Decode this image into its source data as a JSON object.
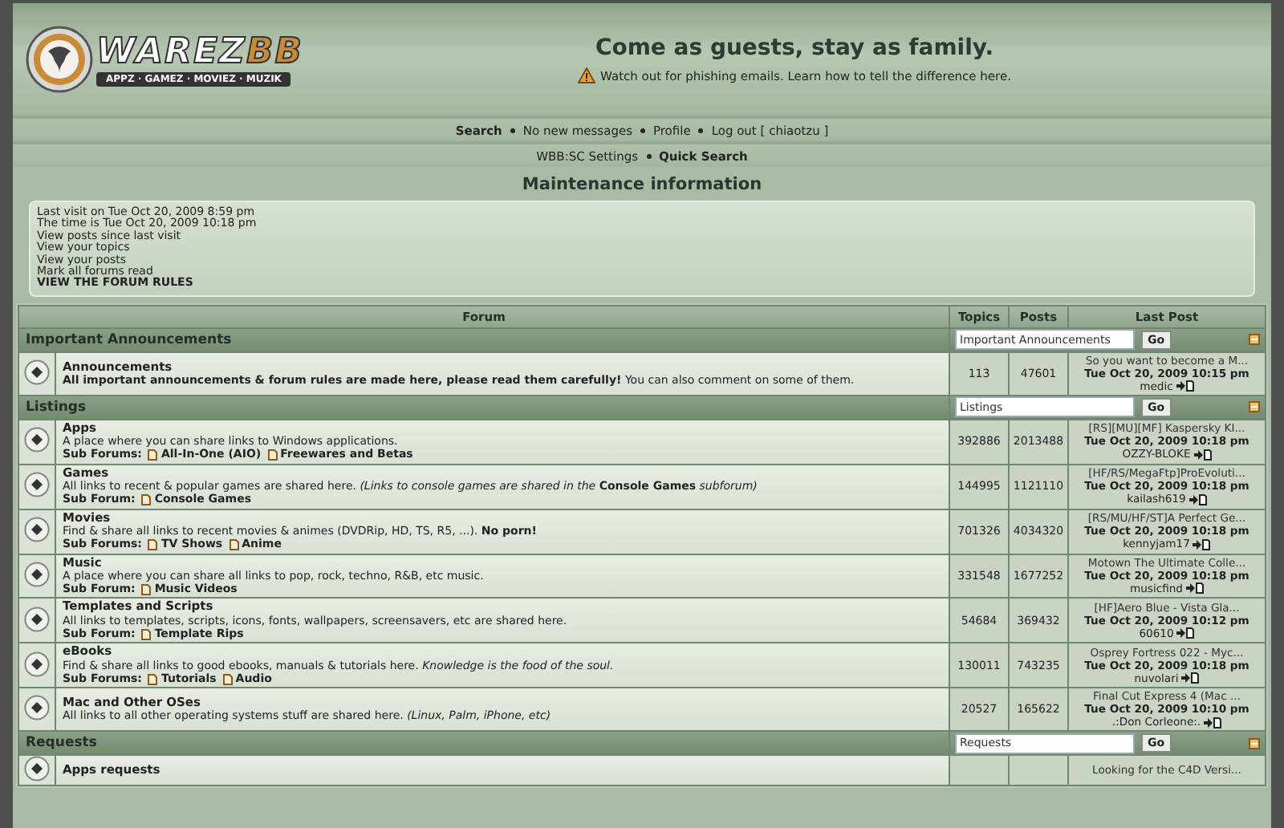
{
  "logo": {
    "word_a": "WAREZ",
    "word_b": "BB",
    "tagline": "APPZ · GAMEZ · MOVIEZ · MUZIK"
  },
  "slogan": "Come as guests, stay as family.",
  "notice": "Watch out for phishing emails. Learn how to tell the difference here.",
  "nav_primary": [
    {
      "text": "Search",
      "bold": true
    },
    {
      "text": "No new messages",
      "bold": false
    },
    {
      "text": "Profile",
      "bold": false
    },
    {
      "text": "Log out [ chiaotzu ]",
      "bold": false
    }
  ],
  "nav_secondary": [
    {
      "text": "WBB:SC Settings",
      "bold": false
    },
    {
      "text": "Quick Search",
      "bold": true
    }
  ],
  "page_title": "Maintenance information",
  "info_lines": [
    {
      "text": "Last visit on Tue Oct 20, 2009 8:59 pm",
      "bold": false
    },
    {
      "text": "The time is Tue Oct 20, 2009 10:18 pm",
      "bold": false
    },
    {
      "text": "View posts since last visit",
      "bold": false
    },
    {
      "text": "View your topics",
      "bold": false
    },
    {
      "text": "View your posts",
      "bold": false
    },
    {
      "text": "Mark all forums read",
      "bold": false
    },
    {
      "text": "VIEW THE FORUM RULES",
      "bold": true
    }
  ],
  "table": {
    "columns": [
      "Forum",
      "Topics",
      "Posts",
      "Last Post"
    ],
    "categories": [
      {
        "name": "Important Announcements",
        "jump_value": "Important Announcements",
        "go_label": "Go",
        "forums": [
          {
            "name": "Announcements",
            "description": "**All important announcements & forum rules are made here, please read them carefully!** You can also comment on some of them.",
            "topics": "113",
            "posts": "47601",
            "last_post": {
              "title": "So you want to become a M...",
              "date": "Tue Oct 20, 2009 10:15 pm",
              "author": "medic"
            }
          }
        ]
      },
      {
        "name": "Listings",
        "jump_value": "Listings",
        "go_label": "Go",
        "forums": [
          {
            "name": "Apps",
            "description": "A place where you can share links to Windows applications.",
            "sub_label": "Sub Forums:",
            "sub_forums": [
              "All-In-One (AIO)",
              "Freewares and Betas"
            ],
            "topics": "392886",
            "posts": "2013488",
            "last_post": {
              "title": "[RS][MU][MF] Kaspersky KI...",
              "date": "Tue Oct 20, 2009 10:18 pm",
              "author": "OZZY-BLOKE"
            }
          },
          {
            "name": "Games",
            "description": "All links to recent & popular games are shared here. *(Links to console games are shared in the* **Console Games** *subforum)*",
            "sub_label": "Sub Forum:",
            "sub_forums": [
              "Console Games"
            ],
            "topics": "144995",
            "posts": "1121110",
            "last_post": {
              "title": "[HF/RS/MegaFtp]ProEvoluti...",
              "date": "Tue Oct 20, 2009 10:18 pm",
              "author": "kailash619"
            }
          },
          {
            "name": "Movies",
            "description": "Find & share all links to recent movies & animes (DVDRip, HD, TS, R5, ...). **No porn!**",
            "sub_label": "Sub Forums:",
            "sub_forums": [
              "TV Shows",
              "Anime"
            ],
            "topics": "701326",
            "posts": "4034320",
            "last_post": {
              "title": "[RS/MU/HF/ST]A Perfect Ge...",
              "date": "Tue Oct 20, 2009 10:18 pm",
              "author": "kennyjam17"
            }
          },
          {
            "name": "Music",
            "description": "A place where you can share all links to pop, rock, techno, R&B, etc music.",
            "sub_label": "Sub Forum:",
            "sub_forums": [
              "Music Videos"
            ],
            "topics": "331548",
            "posts": "1677252",
            "last_post": {
              "title": "Motown The Ultimate Colle...",
              "date": "Tue Oct 20, 2009 10:18 pm",
              "author": "musicfind"
            }
          },
          {
            "name": "Templates and Scripts",
            "description": "All links to templates, scripts, icons, fonts, wallpapers, screensavers, etc are shared here.",
            "sub_label": "Sub Forum:",
            "sub_forums": [
              "Template Rips"
            ],
            "topics": "54684",
            "posts": "369432",
            "last_post": {
              "title": "[HF]Aero Blue - Vista Gla...",
              "date": "Tue Oct 20, 2009 10:12 pm",
              "author": "60610"
            }
          },
          {
            "name": "eBooks",
            "description": "Find & share all links to good ebooks, manuals & tutorials here. *Knowledge is the food of the soul.*",
            "sub_label": "Sub Forums:",
            "sub_forums": [
              "Tutorials",
              "Audio"
            ],
            "topics": "130011",
            "posts": "743235",
            "last_post": {
              "title": "Osprey Fortress 022 - Myc...",
              "date": "Tue Oct 20, 2009 10:18 pm",
              "author": "nuvolari"
            }
          },
          {
            "name": "Mac and Other OSes",
            "description": "All links to all other operating systems stuff are shared here. *(Linux, Palm, iPhone, etc)*",
            "topics": "20527",
            "posts": "165622",
            "last_post": {
              "title": "Final Cut Express 4 (Mac ...",
              "date": "Tue Oct 20, 2009 10:10 pm",
              "author": ".:Don Corleone:."
            }
          }
        ]
      },
      {
        "name": "Requests",
        "jump_value": "Requests",
        "go_label": "Go",
        "forums": [
          {
            "name": "Apps requests",
            "last_post": {
              "title": "Looking for the C4D Versi..."
            }
          }
        ]
      }
    ]
  }
}
